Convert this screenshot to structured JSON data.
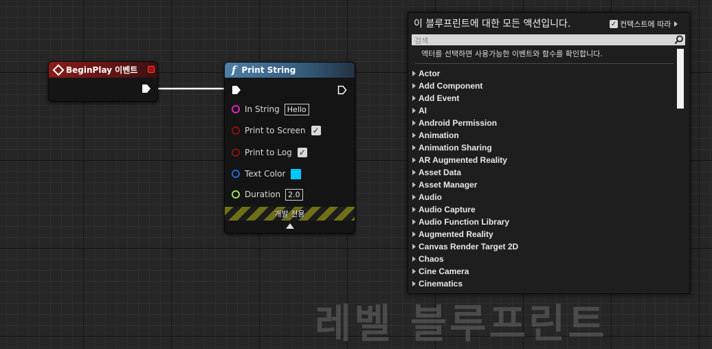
{
  "watermark": "레벨 블루프린트",
  "event_node": {
    "title": "BeginPlay 이벤트",
    "header_color": "#8a1b1b"
  },
  "function_node": {
    "title": "Print String",
    "header_color": "#4e7fa8",
    "pins": {
      "in_string": {
        "label": "In String",
        "value": "Hello",
        "pin_color": "#e020c0"
      },
      "print_to_screen": {
        "label": "Print to Screen",
        "checked": true,
        "pin_color": "#8a1010"
      },
      "print_to_log": {
        "label": "Print to Log",
        "checked": true,
        "pin_color": "#8a1010"
      },
      "text_color": {
        "label": "Text Color",
        "value_color": "#00c8ff",
        "pin_color": "#1a6ad0"
      },
      "duration": {
        "label": "Duration",
        "value": "2.0",
        "pin_color": "#a0e060"
      }
    },
    "dev_only_label": "개발 전용"
  },
  "action_menu": {
    "title": "이 블루프린트에 대한 모든 액션입니다.",
    "context_sensitive_label": "컨텍스트에 따라",
    "context_sensitive_checked": true,
    "search_placeholder": "검색",
    "hint": "액터를 선택하면 사용가능한 이벤트와 함수를 확인합니다.",
    "categories": [
      "Actor",
      "Add Component",
      "Add Event",
      "AI",
      "Android Permission",
      "Animation",
      "Animation Sharing",
      "AR Augmented Reality",
      "Asset Data",
      "Asset Manager",
      "Audio",
      "Audio Capture",
      "Audio Function Library",
      "Augmented Reality",
      "Canvas Render Target 2D",
      "Chaos",
      "Cine Camera",
      "Cinematics"
    ]
  }
}
